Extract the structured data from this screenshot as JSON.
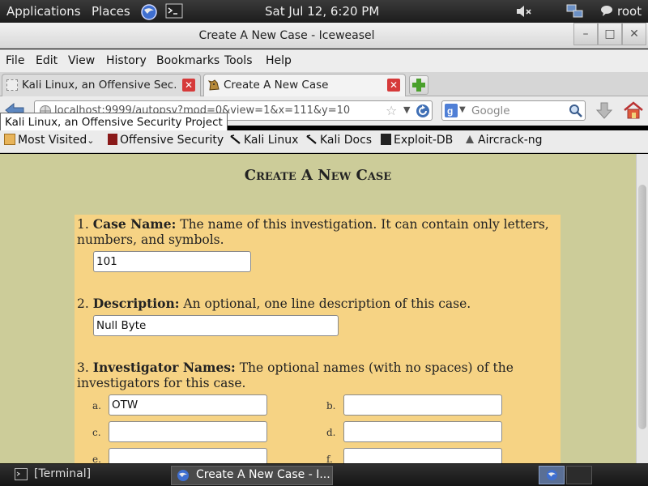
{
  "top_panel": {
    "applications": "Applications",
    "places": "Places",
    "clock": "Sat Jul 12,  6:20 PM",
    "user": "root"
  },
  "window": {
    "title": "Create A New Case - Iceweasel",
    "minimize": "–",
    "maximize": "□",
    "close": "✕"
  },
  "menu": {
    "file": "File",
    "edit": "Edit",
    "view": "View",
    "history": "History",
    "bookmarks": "Bookmarks",
    "tools": "Tools",
    "help": "Help"
  },
  "tabs": [
    {
      "label": "Kali Linux, an Offensive Sec..."
    },
    {
      "label": "Create A New Case"
    }
  ],
  "nav": {
    "url": "localhost:9999/autopsy?mod=0&view=1&x=111&y=10",
    "search_placeholder": "Google",
    "tooltip": "Kali Linux, an Offensive Security Project"
  },
  "bookmarks": [
    "Most Visited",
    "Offensive Security",
    "Kali Linux",
    "Kali Docs",
    "Exploit-DB",
    "Aircrack-ng"
  ],
  "page": {
    "heading": "Create A New Case",
    "q1": {
      "num": "1.",
      "label": "Case Name:",
      "text": "The name of this investigation. It can contain only letters, numbers, and symbols.",
      "value": "101"
    },
    "q2": {
      "num": "2.",
      "label": "Description:",
      "text": "An optional, one line description of this case.",
      "value": "Null Byte"
    },
    "q3": {
      "num": "3.",
      "label": "Investigator Names:",
      "text": "The optional names (with no spaces) of the investigators for this case.",
      "letters": [
        "a.",
        "b.",
        "c.",
        "d.",
        "e.",
        "f."
      ],
      "values": [
        "OTW",
        "",
        "",
        "",
        "",
        ""
      ]
    }
  },
  "taskbar": {
    "terminal": "[Terminal]",
    "browser": "Create A New Case - I..."
  },
  "colors": {
    "page_bg": "#cccc99",
    "form_bg": "#f6d384",
    "close_red": "#d63a3a"
  }
}
